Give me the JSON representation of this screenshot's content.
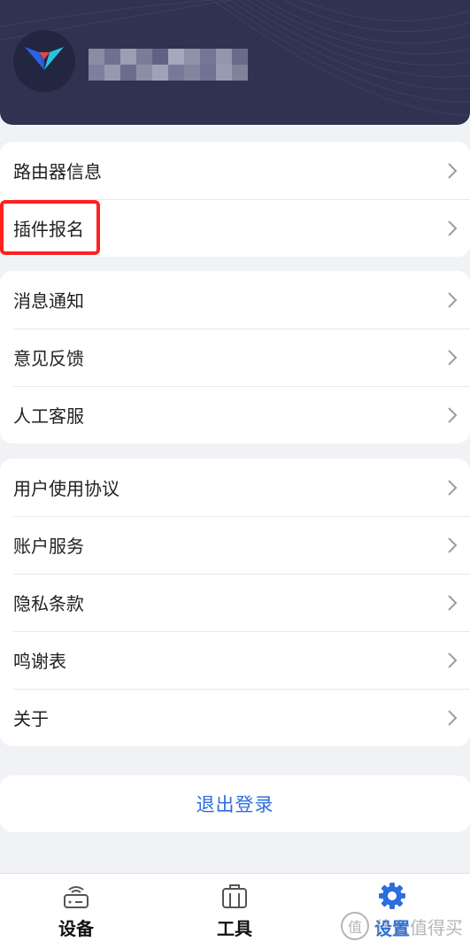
{
  "header": {
    "avatar_icon": "brand-logo-icon",
    "username_blurred": ""
  },
  "sections": [
    {
      "items": [
        {
          "label": "路由器信息",
          "icon": "chevron-right-icon"
        },
        {
          "label": "插件报名",
          "icon": "chevron-right-icon"
        }
      ]
    },
    {
      "items": [
        {
          "label": "消息通知",
          "icon": "chevron-right-icon"
        },
        {
          "label": "意见反馈",
          "icon": "chevron-right-icon"
        },
        {
          "label": "人工客服",
          "icon": "chevron-right-icon"
        }
      ]
    },
    {
      "items": [
        {
          "label": "用户使用协议",
          "icon": "chevron-right-icon"
        },
        {
          "label": "账户服务",
          "icon": "chevron-right-icon"
        },
        {
          "label": "隐私条款",
          "icon": "chevron-right-icon"
        },
        {
          "label": "鸣谢表",
          "icon": "chevron-right-icon"
        },
        {
          "label": "关于",
          "icon": "chevron-right-icon"
        }
      ]
    }
  ],
  "logout_label": "退出登录",
  "tabbar": {
    "tabs": [
      {
        "label": "设备",
        "icon": "router-icon"
      },
      {
        "label": "工具",
        "icon": "toolbox-icon"
      },
      {
        "label": "设置",
        "icon": "gear-icon",
        "active": true
      }
    ]
  },
  "watermark": {
    "icon": "值",
    "text": "什么值得买"
  },
  "colors": {
    "header_bg": "#2f3250",
    "accent": "#2b6fde",
    "highlight": "#ff2020",
    "page_bg": "#f1f2f6"
  }
}
